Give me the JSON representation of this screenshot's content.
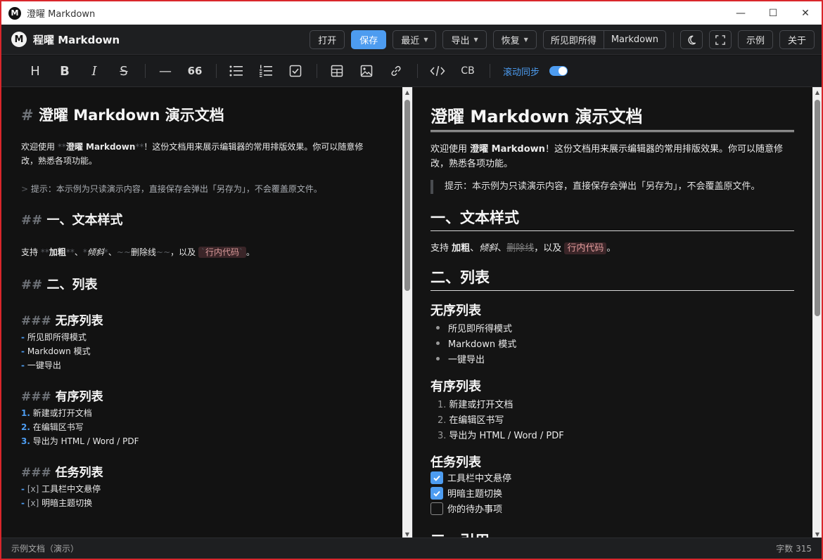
{
  "window": {
    "title": "澄曜 Markdown",
    "app_icon": "M"
  },
  "header": {
    "logo": "M",
    "brand": "程曜 Markdown",
    "buttons": {
      "open": "打开",
      "save": "保存",
      "recent": "最近",
      "export": "导出",
      "restore": "恢复",
      "wysiwyg": "所见即所得",
      "markdown": "Markdown",
      "example": "示例",
      "about": "关于"
    },
    "icons": [
      "moon-icon",
      "fullscreen-icon"
    ]
  },
  "toolbar": {
    "heading": "H",
    "bold": "B",
    "italic": "I",
    "strike": "S",
    "hr": "—",
    "quote": "66",
    "code_block": "CB",
    "sync_label": "滚动同步",
    "sync_on": true
  },
  "editor": {
    "h1_mark": "#",
    "h1": "澄曜 Markdown 演示文档",
    "intro_a": "欢迎使用 ",
    "intro_marks": "**",
    "intro_bold": "澄曜 Markdown",
    "intro_b": "！这份文档用来展示编辑器的常用排版效果。你可以随意修",
    "intro_c": "改，熟悉各项功能。",
    "quote_mark": ">",
    "quote": " 提示：本示例为只读演示内容，直接保存会弹出「另存为」，不会覆盖原文件。",
    "h2_mark": "##",
    "h2a": "一、文本样式",
    "styles_a": "支持 ",
    "styles_bold": "加粗",
    "styles_sep1": "、",
    "styles_italic": "倾斜",
    "styles_sep2": "、",
    "styles_strike": "删除线",
    "styles_b": "，以及 ",
    "styles_code": "行内代码",
    "styles_c": "。",
    "star2": "**",
    "star1": "*",
    "tilde": "~~",
    "btick": "`",
    "h2b": "二、列表",
    "h3_mark": "###",
    "h3a": "无序列表",
    "dash": "-",
    "ul": [
      "所见即所得模式",
      "Markdown 模式",
      "一键导出"
    ],
    "h3b": "有序列表",
    "ol_nums": [
      "1.",
      "2.",
      "3."
    ],
    "ol": [
      "新建或打开文档",
      "在编辑区书写",
      "导出为 HTML / Word / PDF"
    ],
    "h3c": "任务列表",
    "task_marks": [
      "[x]",
      "[x]"
    ],
    "tasks": [
      "工具栏中文悬停",
      "明暗主题切换"
    ]
  },
  "preview": {
    "h1": "澄曜 Markdown 演示文档",
    "intro_a": "欢迎使用 ",
    "intro_bold": "澄曜 Markdown",
    "intro_b": "！这份文档用来展示编辑器的常用排版效果。你可以随意修",
    "intro_c": "改，熟悉各项功能。",
    "quote": "提示：本示例为只读演示内容，直接保存会弹出「另存为」，不会覆盖原文件。",
    "h2a": "一、文本样式",
    "styles_a": "支持 ",
    "styles_bold": "加粗",
    "styles_sep1": "、",
    "styles_italic": "倾斜",
    "styles_sep2": "、",
    "styles_strike": "删除线",
    "styles_b": "，以及 ",
    "styles_code": "行内代码",
    "styles_c": "。",
    "h2b": "二、列表",
    "h3a": "无序列表",
    "ul": [
      "所见即所得模式",
      "Markdown 模式",
      "一键导出"
    ],
    "h3b": "有序列表",
    "ol_nums": [
      "1.",
      "2.",
      "3."
    ],
    "ol": [
      "新建或打开文档",
      "在编辑区书写",
      "导出为 HTML / Word / PDF"
    ],
    "h3c": "任务列表",
    "tasks": [
      {
        "label": "工具栏中文悬停",
        "done": true
      },
      {
        "label": "明暗主题切换",
        "done": true
      },
      {
        "label": "你的待办事项",
        "done": false
      }
    ],
    "h2c_partial": "三、引用"
  },
  "status": {
    "left": "示例文档（演示）",
    "right": "字数 315"
  },
  "colors": {
    "accent": "#4d9cf0",
    "border": "#d9262b"
  }
}
